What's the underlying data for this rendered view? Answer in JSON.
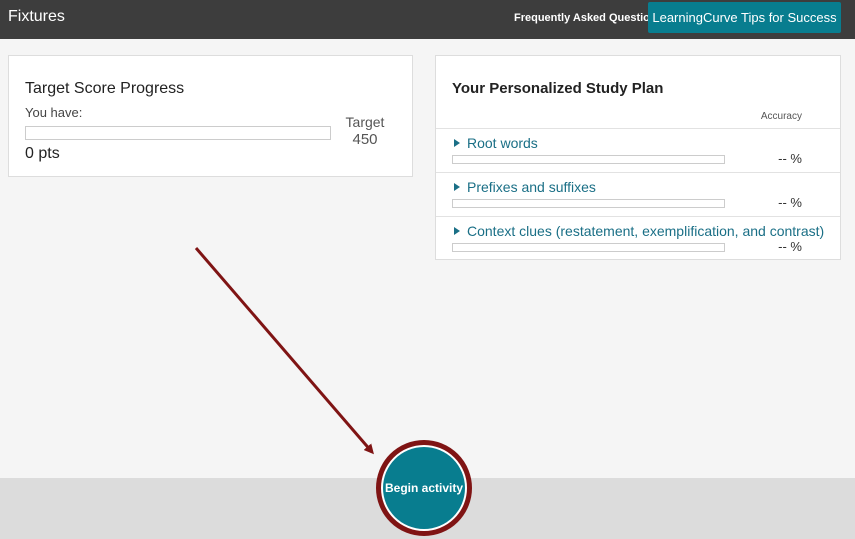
{
  "header": {
    "title": "Fixtures",
    "faq_label": "Frequently Asked Questions",
    "tips_label": "LearningCurve Tips for Success"
  },
  "score_card": {
    "title": "Target Score Progress",
    "you_have_label": "You have:",
    "points": "0 pts",
    "progress": 0,
    "target_label": "Target",
    "target_value": "450"
  },
  "study_plan": {
    "title": "Your Personalized Study Plan",
    "accuracy_label": "Accuracy",
    "topics": [
      {
        "label": "Root words",
        "accuracy": "-- %",
        "progress": 0
      },
      {
        "label": "Prefixes and suffixes",
        "accuracy": "-- %",
        "progress": 0
      },
      {
        "label": "Context clues (restatement, exemplification, and contrast)",
        "accuracy": "-- %",
        "progress": 0
      }
    ]
  },
  "begin": {
    "label": "Begin activity"
  },
  "colors": {
    "accent": "#087d8f",
    "header_bg": "#3d3d3d",
    "highlight_ring": "#7f1414"
  }
}
